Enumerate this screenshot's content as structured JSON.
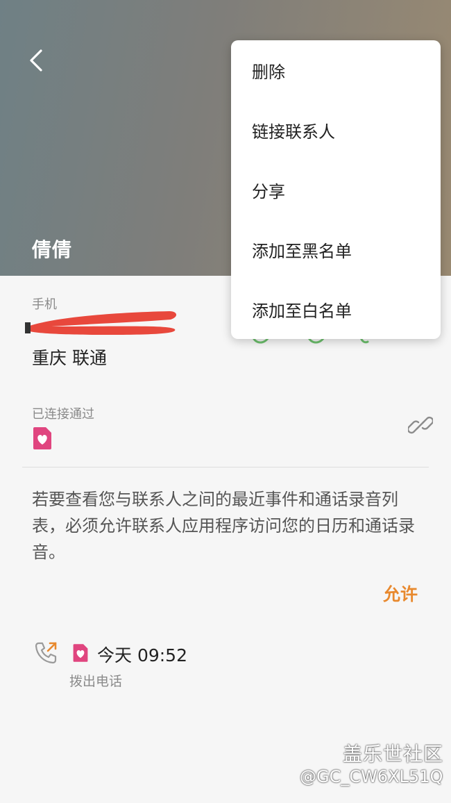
{
  "contact": {
    "name": "倩倩",
    "phone_label": "手机",
    "carrier": "重庆 联通",
    "connected_label": "已连接通过"
  },
  "notice": {
    "text": "若要查看您与联系人之间的最近事件和通话录音列表，必须允许联系人应用程序访问您的日历和通话录音。",
    "allow_label": "允许"
  },
  "call_log": {
    "time": "今天 09:52",
    "type": "拨出电话"
  },
  "menu": {
    "items": [
      {
        "label": "删除"
      },
      {
        "label": "链接联系人"
      },
      {
        "label": "分享"
      },
      {
        "label": "添加至黑名单"
      },
      {
        "label": "添加至白名单"
      }
    ]
  },
  "watermark": {
    "title": "盖乐世社区",
    "user": "@GC_CW6XL51Q"
  },
  "colors": {
    "accent": "#e8892e",
    "sim_icon": "#e0457f",
    "redaction": "#e8483c",
    "icon_green": "#6cbf6c"
  }
}
